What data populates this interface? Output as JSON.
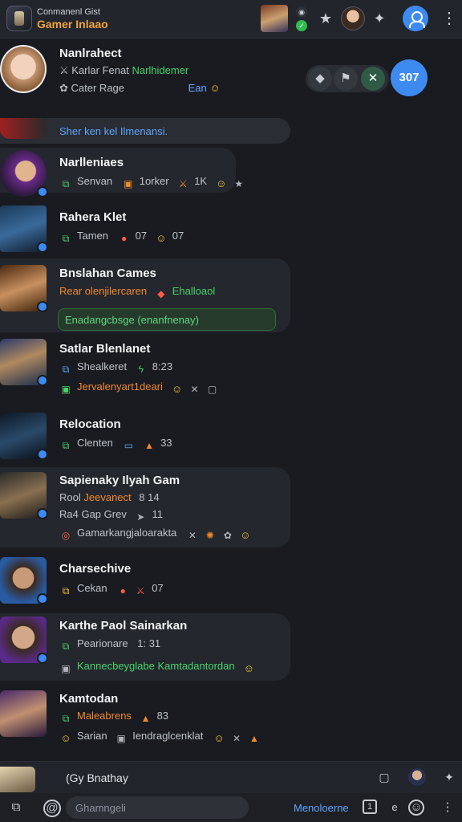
{
  "header": {
    "title": "Conmanenl Gist",
    "subtitle": "Gamer Inlaao",
    "more": "⋮"
  },
  "pinned": {
    "name": "Nanlrahect",
    "line1_a": "Karlar Fenat",
    "line1_b": "Narlhidemer",
    "line2_a": "Cater Rage",
    "line2_b": "Ean",
    "count": "307"
  },
  "notice": {
    "text": "Sher ken kel Ilmenansi."
  },
  "chats": [
    {
      "name": "Narlleniaes",
      "meta": "Senvan",
      "extra": "1orker",
      "count": "1K"
    },
    {
      "name": "Rahera Klet",
      "meta": "Tamen",
      "extra": "07",
      "extra2": "07"
    },
    {
      "name": "Bnslahan Cames",
      "meta": "Rear olenjilercaren",
      "meta2": "Ehalloaol",
      "card": "Enadangcbsge (enanfnenay)"
    },
    {
      "name": "Satlar Blenlanet",
      "meta": "Shealkeret",
      "time": "8:23",
      "card": "Jervalenyart1deari"
    },
    {
      "name": "Relocation",
      "meta": "Clenten",
      "extra": "33"
    },
    {
      "name": "Sapienaky Ilyah Gam",
      "meta": "Rool",
      "meta_b": "Jeevanect",
      "time": "8 14",
      "line2": "Ra4 Gap Grev",
      "line2b": "11",
      "card": "Gamarkangjaloarakta"
    },
    {
      "name": "Charsechive",
      "meta": "Cekan",
      "extra": "07"
    },
    {
      "name": "Karthe Paol Sainarkan",
      "meta": "Pearionare",
      "time": "1: 31",
      "card": "Kannecbeyglabe Kamtadantordan"
    },
    {
      "name": "Kamtodan",
      "meta": "Maleabrens",
      "extra": "83",
      "line2": "Sarian",
      "line2b": "Iendraglcenklat"
    }
  ],
  "reply": {
    "text": "(Gy Bnathay"
  },
  "compose": {
    "placeholder": "Ghamngeli",
    "link": "Menoloerne",
    "char": "e"
  },
  "colors": {
    "accent": "#3d8bf0",
    "green": "#46d36b",
    "orange": "#f08a2e",
    "background": "#191b20"
  }
}
